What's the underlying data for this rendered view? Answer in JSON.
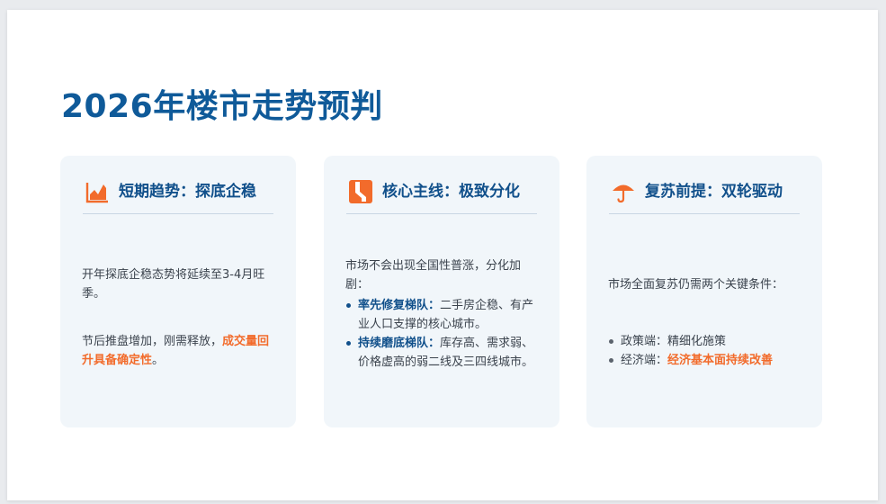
{
  "slide": {
    "title": "2026年楼市走势预判"
  },
  "cards": [
    {
      "heading": "短期趋势：探底企稳",
      "icon": "area-chart-icon",
      "p1": "开年探底企稳态势将延续至3-4月旺季。",
      "p2_lead": "节后推盘增加，刚需释放，",
      "p2_highlight": "成交量回升具备确定性",
      "p2_tail": "。"
    },
    {
      "heading": "核心主线：极致分化",
      "icon": "split-road-icon",
      "intro": "市场不会出现全国性普涨，分化加剧：",
      "items": [
        {
          "term": "率先修复梯队：",
          "text": "二手房企稳、有产业人口支撑的核心城市。"
        },
        {
          "term": "持续磨底梯队：",
          "text": "库存高、需求弱、价格虚高的弱二线及三四线城市。"
        }
      ]
    },
    {
      "heading": "复苏前提：双轮驱动",
      "icon": "umbrella-icon",
      "intro": "市场全面复苏仍需两个关键条件：",
      "items": [
        {
          "label": "政策端：",
          "text": "精细化施策"
        },
        {
          "label": "经济端：",
          "highlight": "经济基本面持续改善"
        }
      ]
    }
  ],
  "colors": {
    "title": "#0f5a99",
    "heading": "#11508b",
    "accent": "#f26b2b",
    "card_bg": "#f1f6fa"
  }
}
